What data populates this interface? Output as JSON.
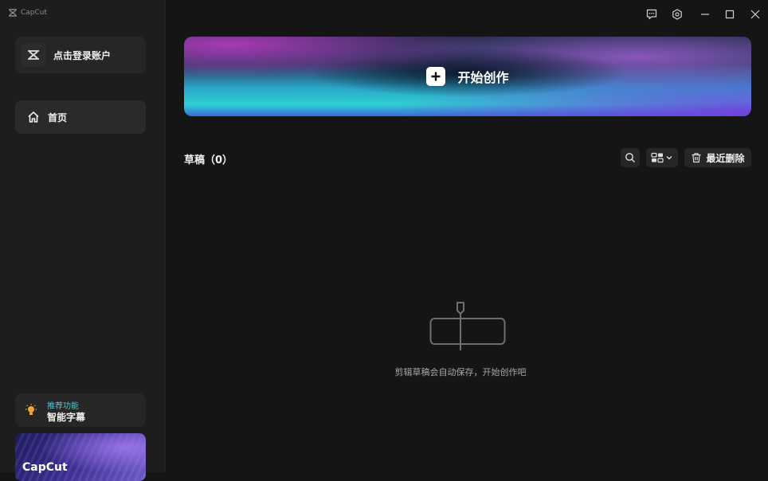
{
  "app": {
    "brand": "CapCut"
  },
  "sidebar": {
    "login_label": "点击登录账户",
    "nav": [
      {
        "label": "首页",
        "icon": "home-icon"
      }
    ],
    "feature": {
      "tag": "推荐功能",
      "name": "智能字幕",
      "icon": "lightbulb-icon"
    },
    "promo": {
      "label": "CapCut"
    }
  },
  "titlebar": {
    "icons": [
      "feedback-icon",
      "settings-icon",
      "minimize-icon",
      "maximize-icon",
      "close-icon"
    ]
  },
  "main": {
    "banner": {
      "label": "开始创作",
      "icon": "plus-icon"
    },
    "drafts": {
      "title": "草稿（0）",
      "recent_delete_label": "最近删除",
      "empty_text": "剪辑草稿会自动保存，开始创作吧"
    }
  },
  "colors": {
    "accent_cyan": "#4fc7d9",
    "background": "#151515",
    "sidebar": "#1d1d1d",
    "card": "#262626"
  }
}
